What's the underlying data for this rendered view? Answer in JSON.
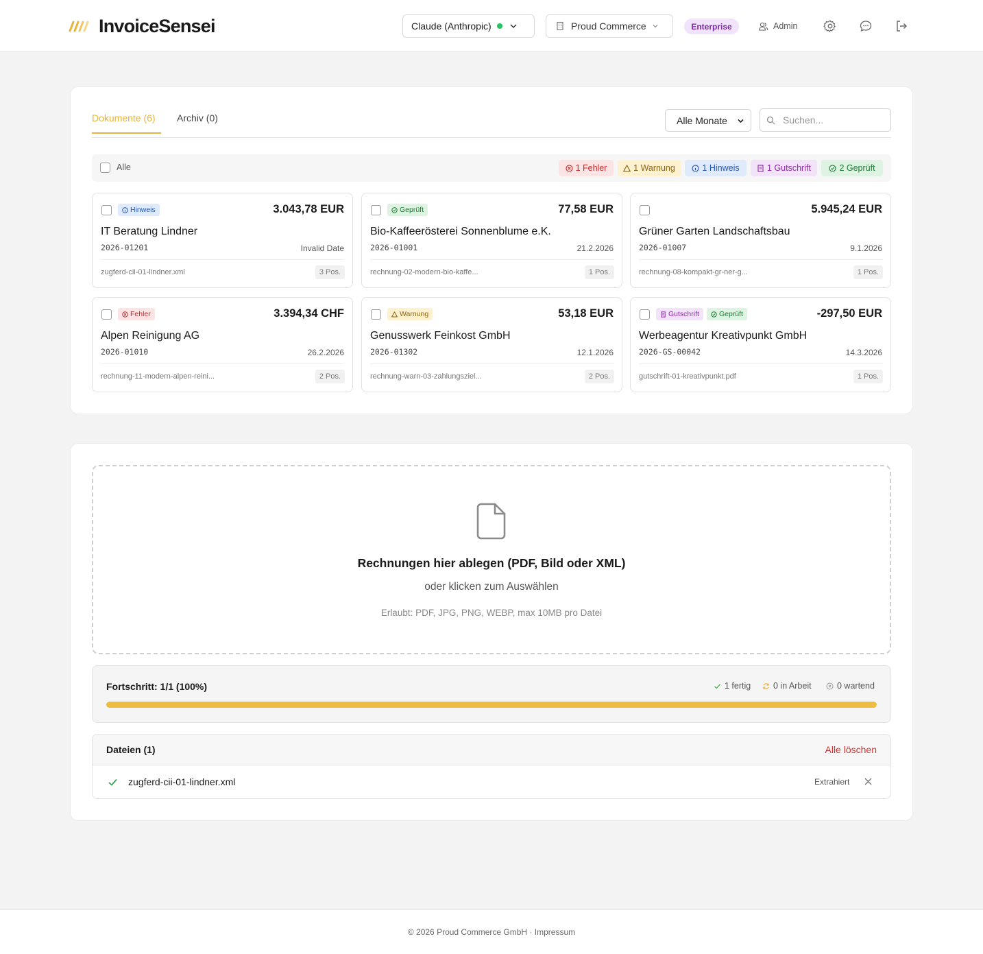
{
  "header": {
    "app_name": "InvoiceSensei",
    "model_selector": "Claude (Anthropic)",
    "company_selector": "Proud Commerce",
    "plan_badge": "Enterprise",
    "user_label": "Admin"
  },
  "tabs": [
    {
      "label": "Dokumente (6)",
      "active": true
    },
    {
      "label": "Archiv (0)",
      "active": false
    }
  ],
  "month_filter": "Alle Monate",
  "search": {
    "placeholder": "Suchen...",
    "value": ""
  },
  "select_all_label": "Alle",
  "summary_chips": [
    {
      "label": "1 Fehler",
      "icon": "error-icon",
      "bg": "#fde4e4",
      "color": "#c62828"
    },
    {
      "label": "1 Warnung",
      "icon": "warning-icon",
      "bg": "#fdf1cf",
      "color": "#8a6412"
    },
    {
      "label": "1 Hinweis",
      "icon": "info-icon",
      "bg": "#dfeafc",
      "color": "#2456b3"
    },
    {
      "label": "1 Gutschrift",
      "icon": "credit-note-icon",
      "bg": "#f3e3f8",
      "color": "#8b2da8"
    },
    {
      "label": "2 Geprüft",
      "icon": "check-circle-icon",
      "bg": "#def3e2",
      "color": "#1f7a35"
    }
  ],
  "documents": [
    {
      "tags": [
        {
          "label": "Hinweis",
          "type": "info"
        }
      ],
      "amount": "3.043,78 EUR",
      "name": "IT Beratung Lindner",
      "number": "2026-01201",
      "date": "Invalid Date",
      "file": "zugferd-cii-01-lindner.xml",
      "positions": "3 Pos."
    },
    {
      "tags": [
        {
          "label": "Geprüft",
          "type": "ok"
        }
      ],
      "amount": "77,58 EUR",
      "name": "Bio-Kaffeerösterei Sonnenblume e.K.",
      "number": "2026-01001",
      "date": "21.2.2026",
      "file": "rechnung-02-modern-bio-kaffe...",
      "positions": "1 Pos."
    },
    {
      "tags": [],
      "amount": "5.945,24 EUR",
      "name": "Grüner Garten Landschaftsbau",
      "number": "2026-01007",
      "date": "9.1.2026",
      "file": "rechnung-08-kompakt-gr-ner-g...",
      "positions": "1 Pos."
    },
    {
      "tags": [
        {
          "label": "Fehler",
          "type": "error"
        }
      ],
      "amount": "3.394,34 CHF",
      "name": "Alpen Reinigung AG",
      "number": "2026-01010",
      "date": "26.2.2026",
      "file": "rechnung-11-modern-alpen-reini...",
      "positions": "2 Pos."
    },
    {
      "tags": [
        {
          "label": "Warnung",
          "type": "warning"
        }
      ],
      "amount": "53,18 EUR",
      "name": "Genusswerk Feinkost GmbH",
      "number": "2026-01302",
      "date": "12.1.2026",
      "file": "rechnung-warn-03-zahlungsziel...",
      "positions": "2 Pos."
    },
    {
      "tags": [
        {
          "label": "Gutschrift",
          "type": "credit"
        },
        {
          "label": "Geprüft",
          "type": "ok"
        }
      ],
      "amount": "-297,50 EUR",
      "name": "Werbeagentur Kreativpunkt GmbH",
      "number": "2026-GS-00042",
      "date": "14.3.2026",
      "file": "gutschrift-01-kreativpunkt.pdf",
      "positions": "1 Pos."
    }
  ],
  "upload": {
    "title": "Rechnungen hier ablegen (PDF, Bild oder XML)",
    "subtitle": "oder klicken zum Auswählen",
    "hint": "Erlaubt: PDF, JPG, PNG, WEBP, max 10MB pro Datei"
  },
  "progress": {
    "title": "Fortschritt: 1/1 (100%)",
    "done": "1 fertig",
    "in_progress": "0 in Arbeit",
    "waiting": "0 wartend",
    "fraction": 1.0,
    "color": "#eebc3f"
  },
  "files": {
    "title": "Dateien (1)",
    "clear_label": "Alle löschen",
    "items": [
      {
        "name": "zugferd-cii-01-lindner.xml",
        "status": "Extrahiert"
      }
    ]
  },
  "footer": {
    "copyright": "© 2026 Proud Commerce GmbH",
    "separator": " · ",
    "impressum": "Impressum"
  },
  "colors": {
    "accent": "#e8b33a",
    "danger": "#d33030",
    "success": "#22c55e"
  }
}
